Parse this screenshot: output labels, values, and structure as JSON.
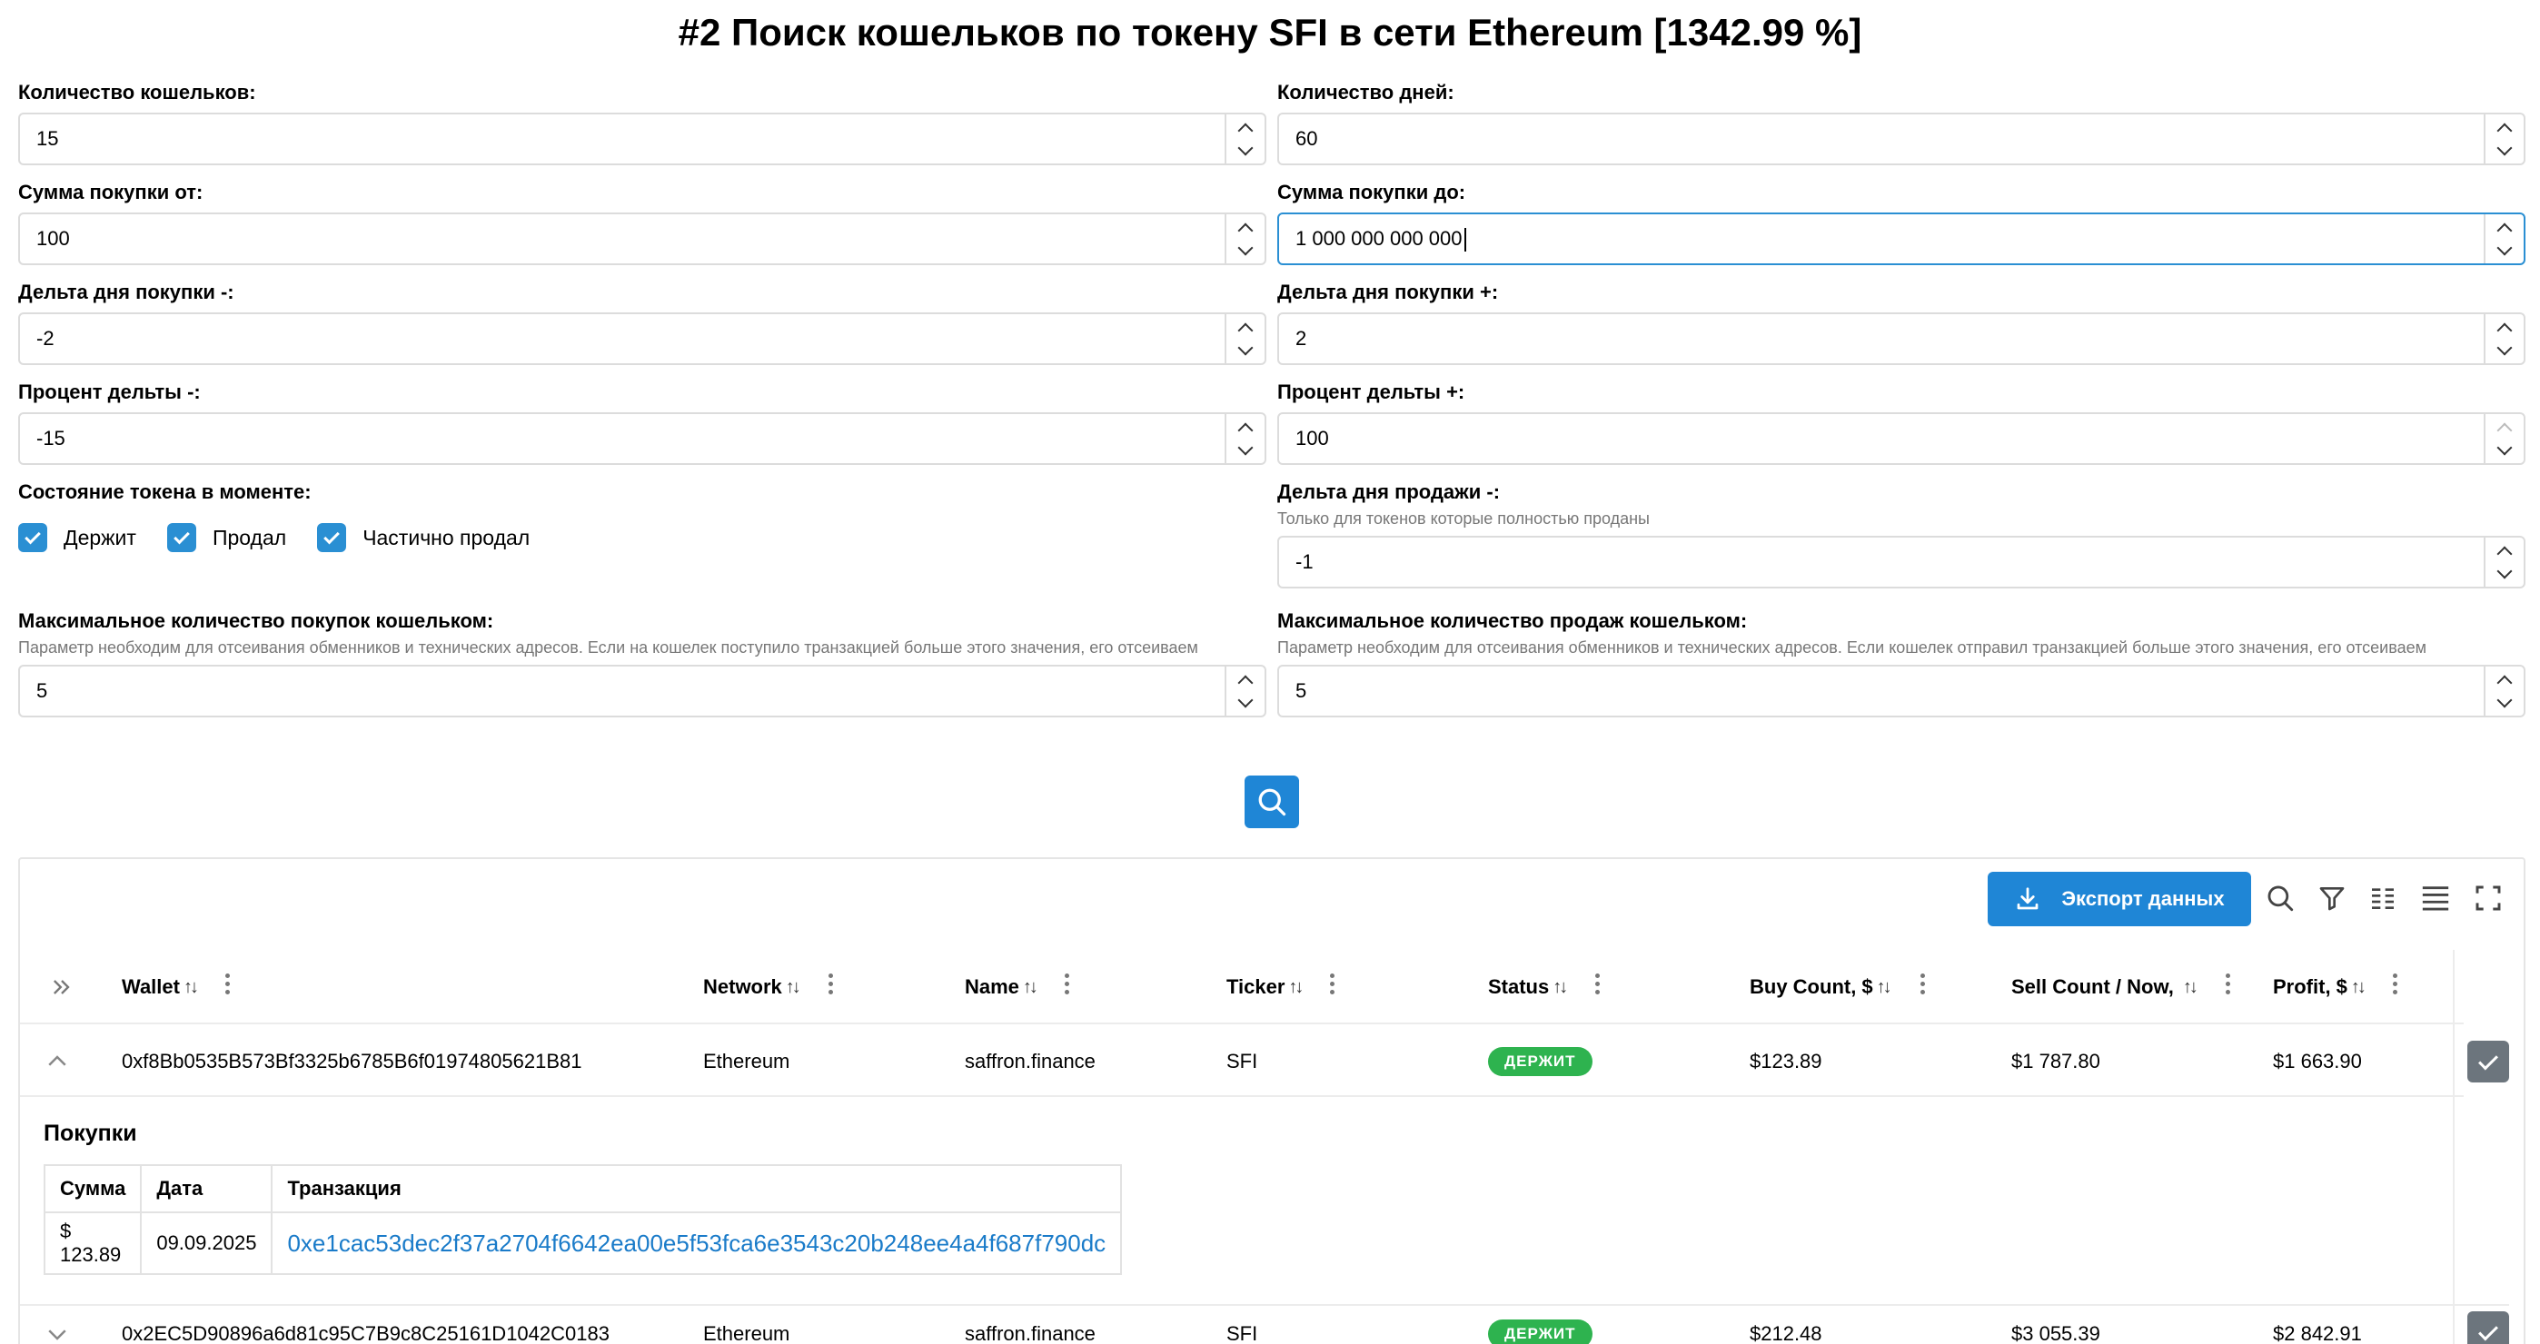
{
  "title": "#2 Поиск кошельков по токену SFI в сети Ethereum [1342.99 %]",
  "form": {
    "wallet_count": {
      "label": "Количество кошельков:",
      "value": "15"
    },
    "days_count": {
      "label": "Количество дней:",
      "value": "60"
    },
    "buy_from": {
      "label": "Сумма покупки от:",
      "value": "100"
    },
    "buy_to": {
      "label": "Сумма покупки до:",
      "value": "1 000 000 000 000"
    },
    "buy_delta_minus": {
      "label": "Дельта дня покупки -:",
      "value": "-2"
    },
    "buy_delta_plus": {
      "label": "Дельта дня покупки +:",
      "value": "2"
    },
    "pct_delta_minus": {
      "label": "Процент дельты -:",
      "value": "-15"
    },
    "pct_delta_plus": {
      "label": "Процент дельты +:",
      "value": "100"
    },
    "token_state": {
      "label": "Состояние токена в моменте:",
      "options": [
        {
          "label": "Держит",
          "checked": true
        },
        {
          "label": "Продал",
          "checked": true
        },
        {
          "label": "Частично продал",
          "checked": true
        }
      ]
    },
    "sell_delta_minus": {
      "label": "Дельта дня продажи -:",
      "hint": "Только для токенов которые полностью проданы",
      "value": "-1"
    },
    "max_buys": {
      "label": "Максимальное количество покупок кошельком:",
      "hint": "Параметр необходим для отсеивания обменников и технических адресов. Если на кошелек поступило транзакцией больше этого значения, его отсеиваем",
      "value": "5"
    },
    "max_sells": {
      "label": "Максимальное количество продаж кошельком:",
      "hint": "Параметр необходим для отсеивания обменников и технических адресов. Если кошелек отправил транзакцией больше этого значения, его отсеиваем",
      "value": "5"
    }
  },
  "table": {
    "export_label": "Экспорт данных",
    "columns": [
      "Wallet",
      "Network",
      "Name",
      "Ticker",
      "Status",
      "Buy Count, $",
      "Sell Count / Now,",
      "Profit, $"
    ],
    "rows": [
      {
        "wallet": "0xf8Bb0535B573Bf3325b6785B6f01974805621B81",
        "network": "Ethereum",
        "name": "saffron.finance",
        "ticker": "SFI",
        "status": "ДЕРЖИТ",
        "buy": "$123.89",
        "sell": "$1 787.80",
        "profit": "$1 663.90",
        "expanded": true
      },
      {
        "wallet": "0x2EC5D90896a6d81c95C7B9c8C25161D1042C0183",
        "network": "Ethereum",
        "name": "saffron.finance",
        "ticker": "SFI",
        "status": "ДЕРЖИТ",
        "buy": "$212.48",
        "sell": "$3 055.39",
        "profit": "$2 842.91",
        "expanded": false
      }
    ],
    "detail": {
      "title": "Покупки",
      "headers": [
        "Сумма",
        "Дата",
        "Транзакция"
      ],
      "rows": [
        {
          "amount": "$ 123.89",
          "date": "09.09.2025",
          "tx": "0xe1cac53dec2f37a2704f6642ea00e5f53fca6e3543c20b248ee4a4f687f790dc"
        }
      ]
    }
  },
  "colors": {
    "accent": "#1f86d6",
    "status_hold": "#2eb34f",
    "link": "#1a7bc9"
  },
  "icons": [
    "search-icon",
    "download-icon",
    "filter-icon",
    "columns-icon",
    "density-icon",
    "fullscreen-icon",
    "expand-all-icon",
    "chevron-up-icon",
    "chevron-down-icon"
  ]
}
